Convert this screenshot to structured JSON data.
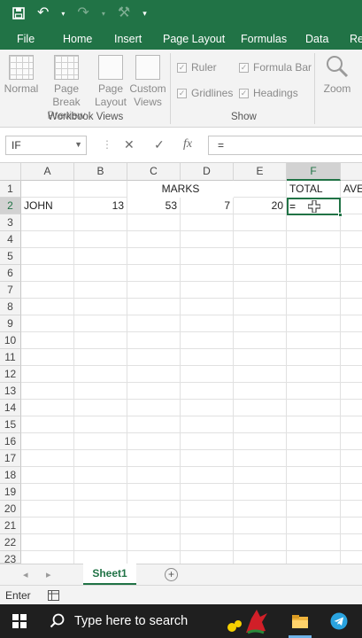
{
  "qat": {
    "save_icon": "save-icon",
    "undo_icon": "undo-icon",
    "redo_icon": "redo-icon",
    "format_icon": "format-painter-icon",
    "customize_icon": "customize-icon"
  },
  "tabs": [
    "File",
    "Home",
    "Insert",
    "Page Layout",
    "Formulas",
    "Data",
    "Re"
  ],
  "ribbon": {
    "workbook_views": {
      "label": "Workbook Views",
      "items": [
        {
          "label1": "Normal",
          "label2": ""
        },
        {
          "label1": "Page Break",
          "label2": "Preview"
        },
        {
          "label1": "Page",
          "label2": "Layout"
        },
        {
          "label1": "Custom",
          "label2": "Views"
        }
      ]
    },
    "show": {
      "label": "Show",
      "items": [
        "Ruler",
        "Formula Bar",
        "Gridlines",
        "Headings"
      ]
    },
    "zoom": {
      "label": "Zoom"
    }
  },
  "formula_bar": {
    "name_box": "IF",
    "cancel": "✕",
    "enter": "✓",
    "fx": "fx",
    "formula": "="
  },
  "columns": [
    "A",
    "B",
    "C",
    "D",
    "E",
    "F"
  ],
  "rows": [
    "1",
    "2",
    "3",
    "4",
    "5",
    "6",
    "7",
    "8",
    "9",
    "10",
    "11",
    "12",
    "13",
    "14",
    "15",
    "16",
    "17",
    "18",
    "19",
    "20",
    "21",
    "22",
    "23"
  ],
  "cells": {
    "c1": "MARKS",
    "f1": "TOTAL",
    "g1": "AVE",
    "a2": "JOHN",
    "b2": "13",
    "c2": "53",
    "d2": "7",
    "e2": "20",
    "f2": "="
  },
  "sheets": [
    "Sheet1"
  ],
  "status": {
    "mode": "Enter"
  },
  "taskbar": {
    "search_placeholder": "Type here to search"
  },
  "colors": {
    "accent": "#217346",
    "taskbar": "#1f1f1f"
  }
}
